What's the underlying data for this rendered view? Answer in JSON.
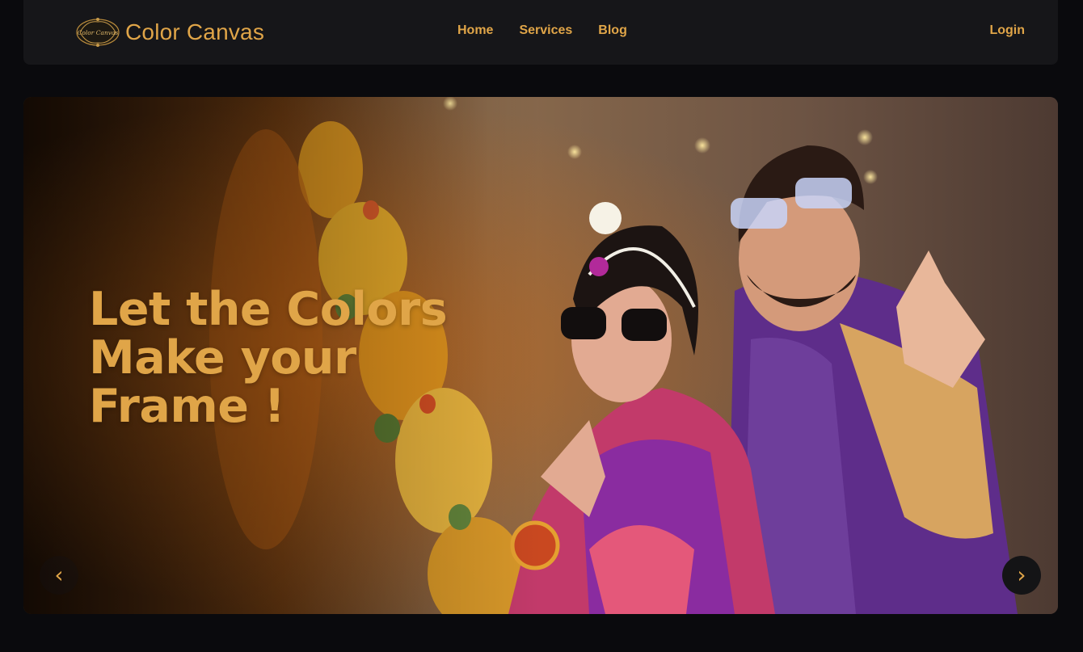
{
  "brand": {
    "name": "Color Canvas",
    "logo_text": "Color Canvas"
  },
  "nav": {
    "links": [
      {
        "label": "Home"
      },
      {
        "label": "Services"
      },
      {
        "label": "Blog"
      }
    ],
    "login": "Login"
  },
  "hero": {
    "headline_lines": [
      "Let the Colors",
      "Make your",
      "Frame !"
    ],
    "prev_glyph": "‹",
    "next_glyph": "›"
  },
  "colors": {
    "accent": "#e0a548",
    "background": "#0a0a0d",
    "navbar": "#161619"
  }
}
